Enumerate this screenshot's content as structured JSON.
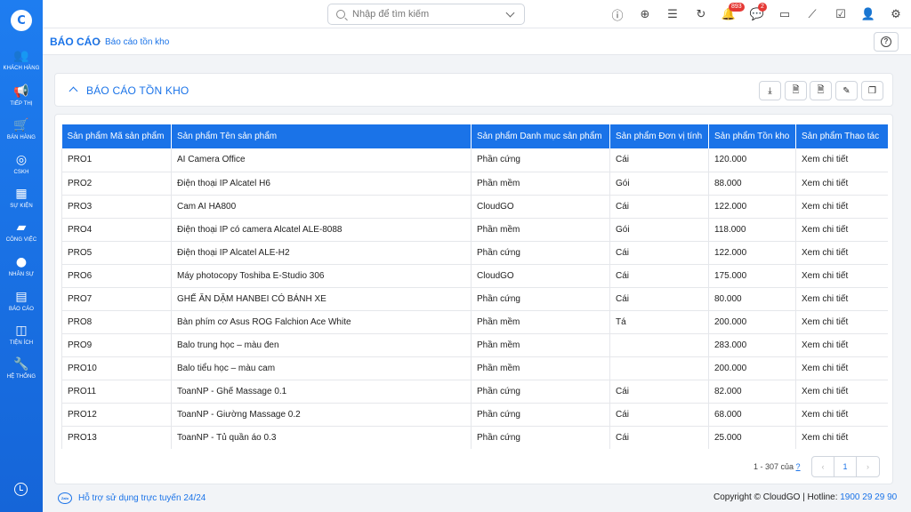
{
  "sidebar": {
    "logo_text": "C",
    "items": [
      {
        "label": "KHÁCH HÀNG",
        "icon": "users-icon",
        "glyph": "👥"
      },
      {
        "label": "TIẾP THỊ",
        "icon": "megaphone-icon",
        "glyph": "📢"
      },
      {
        "label": "BÁN HÀNG",
        "icon": "cart-icon",
        "glyph": "🛒"
      },
      {
        "label": "CSKH",
        "icon": "support-icon",
        "glyph": "◎"
      },
      {
        "label": "SỰ KIỆN",
        "icon": "calendar-icon",
        "glyph": "▦"
      },
      {
        "label": "CÔNG VIỆC",
        "icon": "briefcase-icon",
        "glyph": "▰"
      },
      {
        "label": "NHÂN SỰ",
        "icon": "person-icon",
        "glyph": "●"
      },
      {
        "label": "BÁO CÁO",
        "icon": "chart-icon",
        "glyph": "▤"
      },
      {
        "label": "TIỆN ÍCH",
        "icon": "box-icon",
        "glyph": "◫"
      },
      {
        "label": "HỆ THỐNG",
        "icon": "wrench-icon",
        "glyph": "🔧"
      }
    ]
  },
  "topbar": {
    "search_placeholder": "Nhập để tìm kiếm",
    "notification_count": "893",
    "message_count": "2"
  },
  "breadcrumb": {
    "main": "BÁO CÁO",
    "separator": "›",
    "sub": "Báo cáo tồn kho"
  },
  "report": {
    "title": "BÁO CÁO TỒN KHO"
  },
  "table": {
    "headers": [
      "Sản phẩm Mã sản phẩm",
      "Sản phẩm Tên sản phẩm",
      "Sản phẩm Danh mục sản phẩm",
      "Sản phẩm Đơn vị tính",
      "Sản phẩm Tồn kho",
      "Sản phẩm Thao tác"
    ],
    "rows": [
      [
        "PRO1",
        "AI Camera Office",
        "Phần cứng",
        "Cái",
        "120.000",
        "Xem chi tiết"
      ],
      [
        "PRO2",
        "Điện thoại IP Alcatel H6",
        "Phần mềm",
        "Gói",
        "88.000",
        "Xem chi tiết"
      ],
      [
        "PRO3",
        "Cam AI HA800",
        "CloudGO",
        "Cái",
        "122.000",
        "Xem chi tiết"
      ],
      [
        "PRO4",
        "Điện thoại IP có camera Alcatel ALE-8088",
        "Phần mềm",
        "Gói",
        "118.000",
        "Xem chi tiết"
      ],
      [
        "PRO5",
        "Điện thoại IP Alcatel ALE-H2",
        "Phần cứng",
        "Cái",
        "122.000",
        "Xem chi tiết"
      ],
      [
        "PRO6",
        "Máy photocopy Toshiba E-Studio 306",
        "CloudGO",
        "Cái",
        "175.000",
        "Xem chi tiết"
      ],
      [
        "PRO7",
        "GHẾ ĂN DẶM HANBEI CÓ BÁNH XE",
        "Phần cứng",
        "Cái",
        "80.000",
        "Xem chi tiết"
      ],
      [
        "PRO8",
        "Bàn phím cơ Asus ROG Falchion Ace White",
        "Phần mềm",
        "Tá",
        "200.000",
        "Xem chi tiết"
      ],
      [
        "PRO9",
        "Balo trung học – màu đen",
        "Phần mềm",
        "",
        "283.000",
        "Xem chi tiết"
      ],
      [
        "PRO10",
        "Balo tiểu học – màu cam",
        "Phần mềm",
        "",
        "200.000",
        "Xem chi tiết"
      ],
      [
        "PRO11",
        "ToanNP - Ghế Massage 0.1",
        "Phần cứng",
        "Cái",
        "82.000",
        "Xem chi tiết"
      ],
      [
        "PRO12",
        "ToanNP - Giường Massage 0.2",
        "Phần cứng",
        "Cái",
        "68.000",
        "Xem chi tiết"
      ],
      [
        "PRO13",
        "ToanNP - Tủ quần áo 0.3",
        "Phần cứng",
        "Cái",
        "25.000",
        "Xem chi tiết"
      ],
      [
        "",
        "",
        "",
        "",
        "",
        ""
      ]
    ]
  },
  "pagination": {
    "info": "1 - 307 của",
    "unknown": "?",
    "prev": "‹",
    "current": "1",
    "next": "›"
  },
  "footer": {
    "zalo": "Zalo",
    "support": "Hỗ trợ sử dụng trực tuyến 24/24",
    "copyright": "Copyright © CloudGO | Hotline: ",
    "hotline": "1900 29 29 90"
  }
}
